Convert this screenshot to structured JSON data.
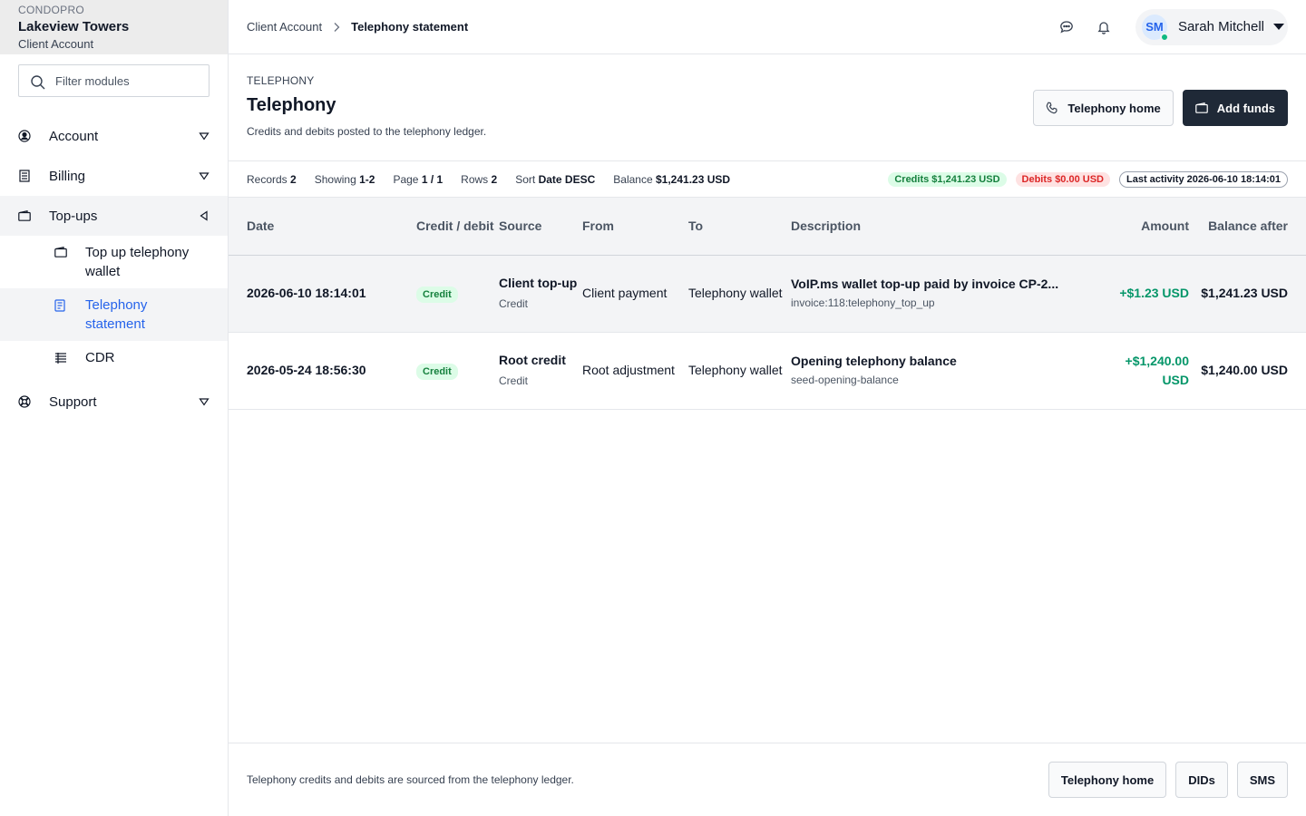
{
  "brand": {
    "kicker": "CONDOPRO",
    "name": "Lakeview Towers",
    "sub": "Client Account"
  },
  "sidebar": {
    "filter_placeholder": "Filter modules",
    "items": [
      {
        "label": "Account",
        "icon": "user-circle-icon"
      },
      {
        "label": "Billing",
        "icon": "receipt-icon"
      },
      {
        "label": "Top-ups",
        "icon": "wallet-icon"
      },
      {
        "label": "Support",
        "icon": "lifebuoy-icon"
      }
    ],
    "sub_items": [
      {
        "label": "Top up telephony wallet",
        "icon": "wallet-icon"
      },
      {
        "label": "Telephony statement",
        "icon": "document-icon"
      },
      {
        "label": "CDR",
        "icon": "list-icon"
      }
    ]
  },
  "topbar": {
    "breadcrumb_parent": "Client Account",
    "breadcrumb_current": "Telephony statement",
    "user_initials": "SM",
    "user_name": "Sarah Mitchell"
  },
  "header": {
    "kicker": "TELEPHONY",
    "title": "Telephony",
    "description": "Credits and debits posted to the telephony ledger.",
    "btn_home": "Telephony home",
    "btn_add": "Add funds"
  },
  "stats": {
    "records_label": "Records",
    "records": "2",
    "showing_label": "Showing",
    "showing": "1-2",
    "page_label": "Page",
    "page": "1 / 1",
    "rows_label": "Rows",
    "rows": "2",
    "sort_label": "Sort",
    "sort": "Date DESC",
    "balance_label": "Balance",
    "balance": "$1,241.23 USD",
    "credits_chip": "Credits $1,241.23 USD",
    "debits_chip": "Debits $0.00 USD",
    "last_activity_chip": "Last activity 2026-06-10 18:14:01"
  },
  "table": {
    "headers": {
      "date": "Date",
      "type": "Credit / debit",
      "source": "Source",
      "from": "From",
      "to": "To",
      "description": "Description",
      "amount": "Amount",
      "balance": "Balance after"
    },
    "rows": [
      {
        "date": "2026-06-10 18:14:01",
        "type": "Credit",
        "source": "Client top-up",
        "source_sub": "Credit",
        "from": "Client payment",
        "to": "Telephony wallet",
        "description": "VoIP.ms wallet top-up paid by invoice CP-2...",
        "description_sub": "invoice:118:telephony_top_up",
        "amount": "+$1.23 USD",
        "balance": "$1,241.23 USD"
      },
      {
        "date": "2026-05-24 18:56:30",
        "type": "Credit",
        "source": "Root credit",
        "source_sub": "Credit",
        "from": "Root adjustment",
        "to": "Telephony wallet",
        "description": "Opening telephony balance",
        "description_sub": "seed-opening-balance",
        "amount": "+$1,240.00 USD",
        "balance": "$1,240.00 USD"
      }
    ]
  },
  "footer": {
    "note": "Telephony credits and debits are sourced from the telephony ledger.",
    "btn_home": "Telephony home",
    "btn_dids": "DIDs",
    "btn_sms": "SMS"
  }
}
